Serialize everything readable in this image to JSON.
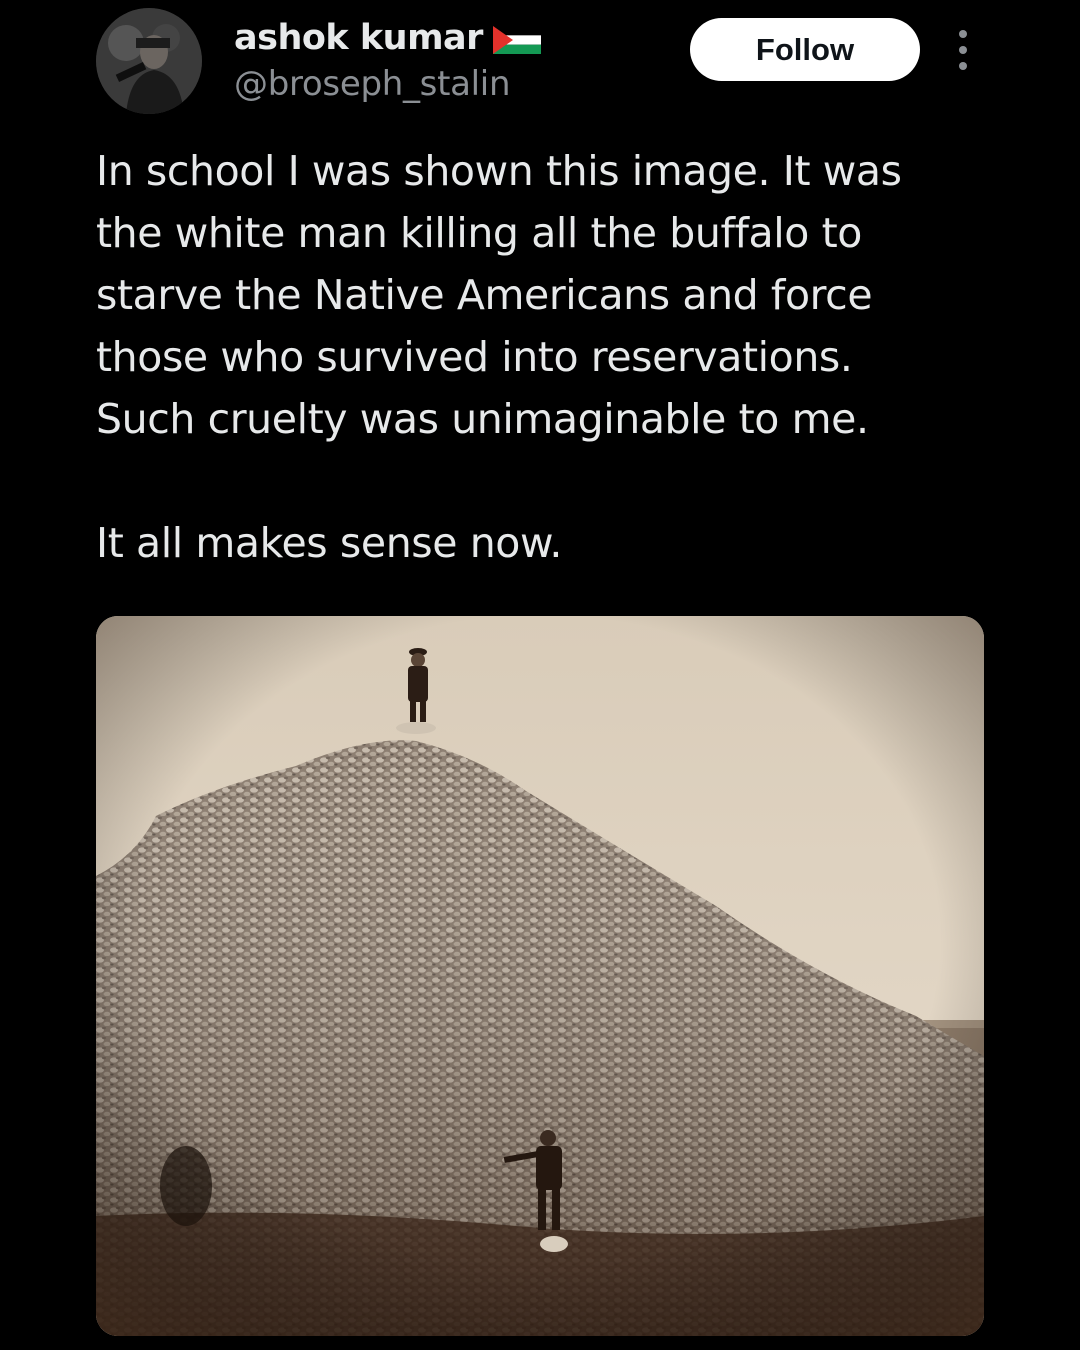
{
  "author": {
    "display_name": "ashok kumar",
    "handle": "@broseph_stalin",
    "flag_icon": "palestine-flag-icon",
    "avatar_icon": "user-avatar"
  },
  "actions": {
    "follow_label": "Follow",
    "more_icon": "more-options-icon"
  },
  "tweet": {
    "lines": [
      "In school I was shown this image. It was",
      "the white man killing all the buffalo to",
      "starve the Native Americans and force",
      "those who survived into reservations.",
      "Such cruelty was unimaginable to me."
    ],
    "closing": "It all makes sense now."
  },
  "media": {
    "kind": "photo"
  },
  "colors": {
    "background": "#000000",
    "text_primary": "#e7e9ea",
    "text_secondary": "#8b8f94",
    "follow_bg": "#ffffff",
    "follow_text": "#0f1419",
    "photo_sky": "#e2d6c5",
    "photo_pile": "#8a7a6a"
  }
}
